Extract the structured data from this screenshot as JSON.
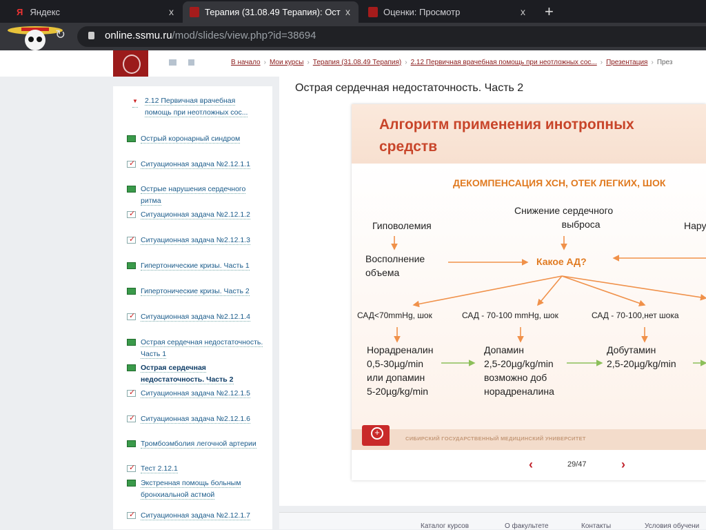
{
  "browser": {
    "tabs": [
      {
        "label": "Яндекс"
      },
      {
        "label": "Терапия (31.08.49 Терапия): Ост"
      },
      {
        "label": "Оценки: Просмотр"
      }
    ],
    "url_host": "online.ssmu.ru",
    "url_path": "/mod/slides/view.php?id=38694"
  },
  "breadcrumb": [
    "В начало",
    "Мои курсы",
    "Терапия (31.08.49 Терапия)",
    "2.12 Первичная врачебная помощь при неотложных сос...",
    "Презентация",
    "През"
  ],
  "sidebar": {
    "section": "2.12 Первичная врачебная помощь при неотложных сос...",
    "items": [
      {
        "label": "Острый коронарный синдром",
        "type": "pres"
      },
      {
        "label": "Ситуационная задача №2.12.1.1",
        "type": "task"
      },
      {
        "label": "Острые нарушения сердечного ритма",
        "type": "pres"
      },
      {
        "label": "Ситуационная задача №2.12.1.2",
        "type": "task"
      },
      {
        "label": "Ситуационная задача №2.12.1.3",
        "type": "task"
      },
      {
        "label": "Гипертонические кризы. Часть 1",
        "type": "pres"
      },
      {
        "label": "Гипертонические кризы. Часть 2",
        "type": "pres"
      },
      {
        "label": "Ситуационная задача №2.12.1.4",
        "type": "task"
      },
      {
        "label": "Острая сердечная недостаточность. Часть 1",
        "type": "pres"
      },
      {
        "label": "Острая сердечная недостаточность. Часть 2",
        "type": "pres"
      },
      {
        "label": "Ситуационная задача №2.12.1.5",
        "type": "task"
      },
      {
        "label": "Ситуационная задача №2.12.1.6",
        "type": "task"
      },
      {
        "label": "Тромбоэмболия легочной артерии",
        "type": "pres"
      },
      {
        "label": "Тест 2.12.1",
        "type": "task"
      },
      {
        "label": "Экстренная помощь больным бронхиальной астмой",
        "type": "pres"
      },
      {
        "label": "Ситуационная задача №2.12.1.7",
        "type": "task"
      }
    ]
  },
  "page_title": "Острая сердечная недостаточность. Часть 2",
  "slide": {
    "title1": "Алгоритм применения инотропных",
    "title2": "средств",
    "subtitle": "ДЕКОМПЕНСАЦИЯ ХСН, ОТЕК ЛЕГКИХ, ШОК",
    "hypo": "Гиповолемия",
    "low1": "Снижение сердечного",
    "low2": "выброса",
    "nar": "Нару",
    "fill1": "Восполнение",
    "fill2": "объема",
    "ad": "Какое АД?",
    "c1": "САД<70mmHg, шок",
    "c2": "САД - 70-100 mmHg, шок",
    "c3": "САД - 70-100,нет шока",
    "n1": "Норадреналин",
    "n2": "0,5-30µg/min",
    "n3": "или допамин",
    "n4": " 5-20µg/kg/min",
    "d1": "Допамин",
    "d2": "2,5-20µg/kg/min",
    "d3": "возможно доб",
    "d4": "норадреналина",
    "b1": "Добутамин",
    "b2": "2,5-20µg/kg/min",
    "university": "СИБИРСКИЙ ГОСУДАРСТВЕННЫЙ МЕДИЦИНСКИЙ УНИВЕРСИТЕТ"
  },
  "pager": "29/47",
  "footer": [
    "Каталог курсов",
    "О факультете",
    "Контакты",
    "Условия обучени"
  ]
}
